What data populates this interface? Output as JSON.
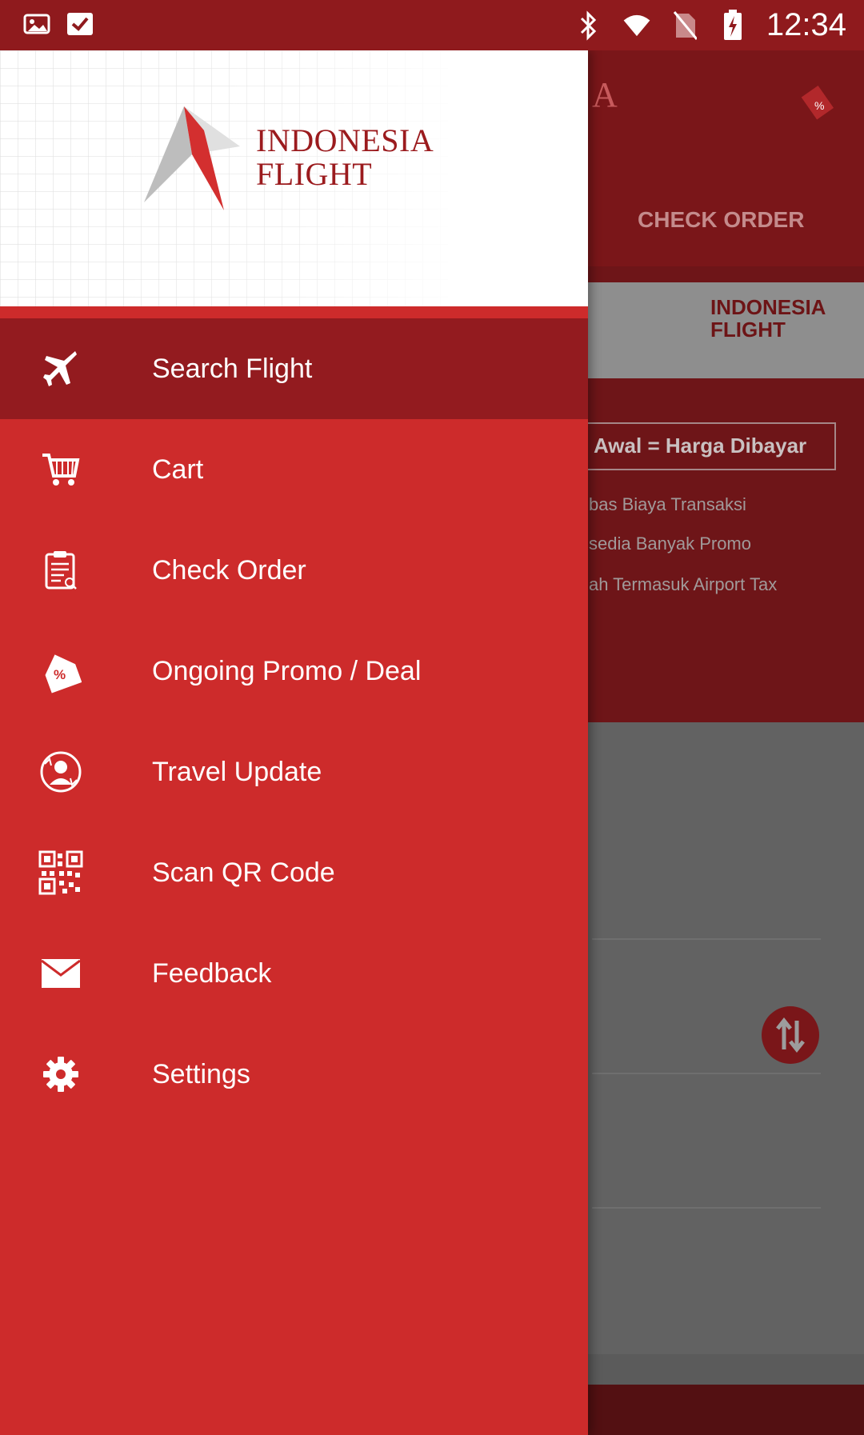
{
  "status_bar": {
    "time": "12:34",
    "icons": [
      "gallery-icon",
      "check-icon",
      "bluetooth-icon",
      "wifi-icon",
      "no-sim-icon",
      "battery-charging-icon"
    ]
  },
  "background": {
    "header_title": "A",
    "tab_check_order": "CHECK ORDER",
    "banner_logo_line1": "INDONESIA",
    "banner_logo_line2": "FLIGHT",
    "price_text": "Awal = Harga Dibayar",
    "lines": [
      "bas Biaya Transaksi",
      "sedia Banyak Promo",
      "ah Termasuk Airport Tax"
    ]
  },
  "drawer": {
    "logo_line1": "INDONESIA",
    "logo_line2": "FLIGHT",
    "items": [
      {
        "label": "Search Flight",
        "icon": "airplane-icon",
        "active": true
      },
      {
        "label": "Cart",
        "icon": "cart-icon",
        "active": false
      },
      {
        "label": "Check Order",
        "icon": "clipboard-icon",
        "active": false
      },
      {
        "label": "Ongoing Promo / Deal",
        "icon": "promo-tag-icon",
        "active": false
      },
      {
        "label": "Travel Update",
        "icon": "travel-update-icon",
        "active": false
      },
      {
        "label": "Scan QR Code",
        "icon": "qr-code-icon",
        "active": false
      },
      {
        "label": "Feedback",
        "icon": "mail-icon",
        "active": false
      },
      {
        "label": "Settings",
        "icon": "settings-gear-icon",
        "active": false
      }
    ]
  },
  "colors": {
    "brand_red": "#cd2b2b",
    "dark_red": "#931b1f",
    "status_bar": "#8f1a1d"
  }
}
